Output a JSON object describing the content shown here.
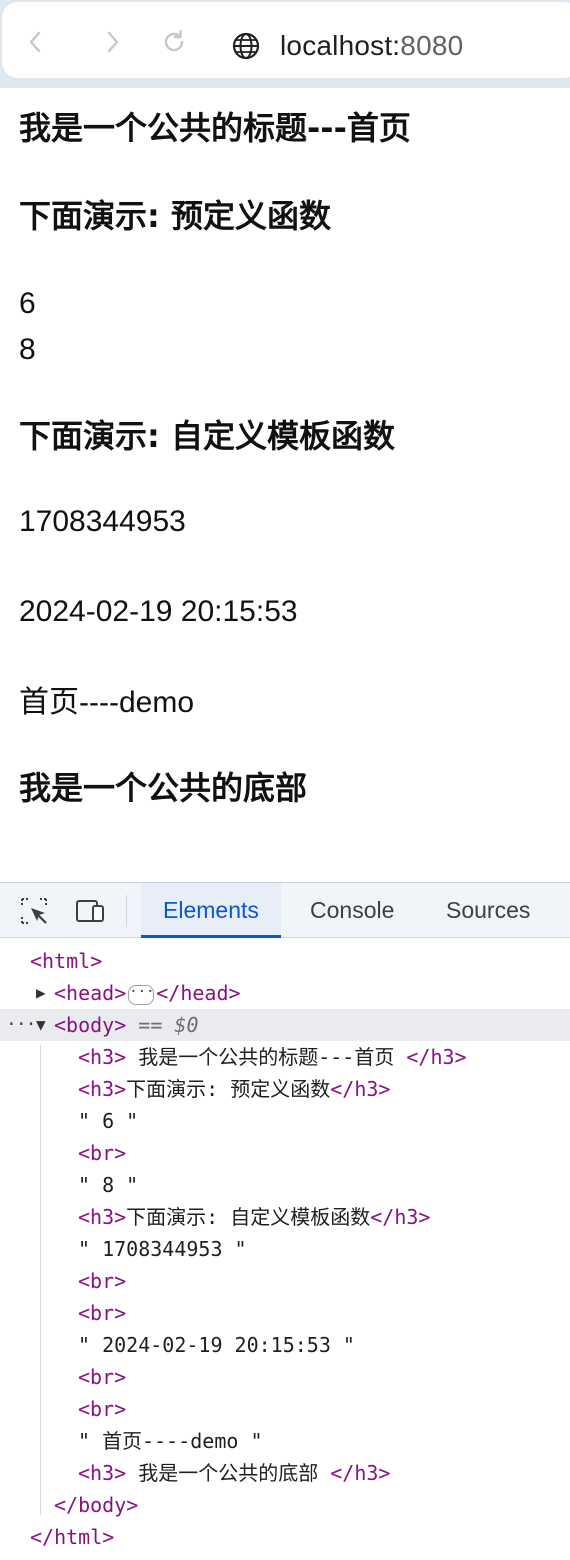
{
  "browser": {
    "address_host": "localhost:",
    "address_port": "8080"
  },
  "page": {
    "header_title": "我是一个公共的标题---首页",
    "section_predefined": "下面演示: 预定义函数",
    "value_6": "6",
    "value_8": "8",
    "section_custom": "下面演示: 自定义模板函数",
    "timestamp": "1708344953",
    "datetime": "2024-02-19 20:15:53",
    "page_name": "首页----demo",
    "footer_title": "我是一个公共的底部"
  },
  "devtools": {
    "tabs": [
      "Elements",
      "Console",
      "Sources"
    ],
    "active_tab": "Elements",
    "tree": {
      "html_open": "<html>",
      "head_open": "<head>",
      "head_ellipsis": "···",
      "head_close": "</head>",
      "body_open": "<body>",
      "body_eq": " == ",
      "body_var": "$0",
      "h3_header": "<h3>",
      "h3_header_text": " 我是一个公共的标题---首页 ",
      "h3_close": "</h3>",
      "h3_predefined_text": "下面演示: 预定义函数",
      "text_6": "\" 6 \"",
      "br": "<br>",
      "text_8": "\" 8 \"",
      "h3_custom_text": "下面演示: 自定义模板函数",
      "text_timestamp": "\" 1708344953 \"",
      "text_datetime": "\" 2024-02-19 20:15:53 \"",
      "text_page": "\" 首页----demo \"",
      "h3_footer_text": " 我是一个公共的底部 ",
      "body_close": "</body>",
      "html_close": "</html>",
      "dots": "···"
    }
  }
}
